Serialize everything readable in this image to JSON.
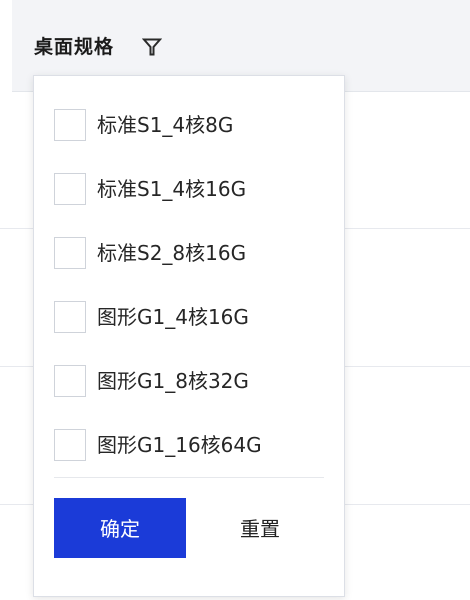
{
  "column": {
    "title": "桌面规格",
    "filter_icon": "filter-icon"
  },
  "filter": {
    "options": [
      {
        "label": "标准S1_4核8G",
        "checked": false
      },
      {
        "label": "标准S1_4核16G",
        "checked": false
      },
      {
        "label": "标准S2_8核16G",
        "checked": false
      },
      {
        "label": "图形G1_4核16G",
        "checked": false
      },
      {
        "label": "图形G1_8核32G",
        "checked": false
      },
      {
        "label": "图形G1_16核64G",
        "checked": false
      }
    ],
    "confirm_label": "确定",
    "reset_label": "重置"
  },
  "colors": {
    "accent": "#1b3bd8",
    "header_bg": "#f3f4f7",
    "border": "#dcdfe6"
  }
}
